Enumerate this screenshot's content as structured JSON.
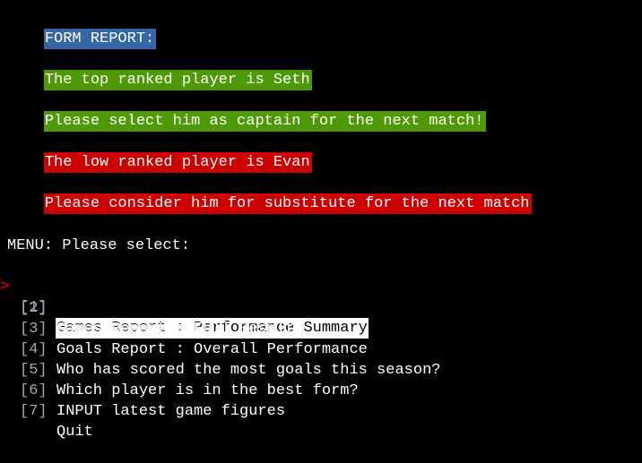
{
  "report": {
    "header": "FORM REPORT:",
    "top_player": "The top ranked player is Seth",
    "top_advice": "Please select him as captain for the next match!",
    "low_player": "The low ranked player is Evan",
    "low_advice": "Please consider him for substitute for the next match"
  },
  "menu": {
    "prompt": "MENU: Please select:",
    "cursor": ">",
    "selected_index": 0,
    "items": [
      {
        "number": "[1]",
        "label": "Games Report : Performance Summary"
      },
      {
        "number": "[2]",
        "label": "Games Report : Full Results"
      },
      {
        "number": "[3]",
        "label": "Goals Report : Overall Performance"
      },
      {
        "number": "[4]",
        "label": "Who has scored the most goals this season?"
      },
      {
        "number": "[5]",
        "label": "Which player is in the best form?"
      },
      {
        "number": "[6]",
        "label": "INPUT latest game figures"
      },
      {
        "number": "[7]",
        "label": "Quit"
      }
    ]
  },
  "colors": {
    "background": "#000000",
    "header_highlight": "#3465a4",
    "good_highlight": "#4e9a06",
    "bad_highlight": "#cc0000",
    "menu_number": "#9ea7b3",
    "cursor": "#cc0000"
  }
}
